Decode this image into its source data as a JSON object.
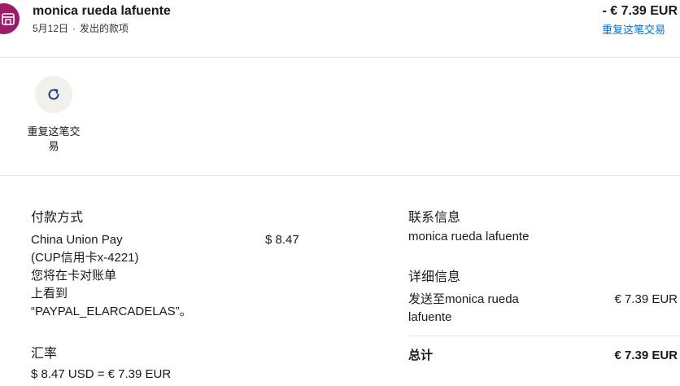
{
  "header": {
    "merchant_name": "monica rueda lafuente",
    "date": "5月12日",
    "separator": "·",
    "type": "发出的款项",
    "amount": "- € 7.39 EUR",
    "repeat_link": "重复这笔交易"
  },
  "actions": {
    "repeat_label": "重复这笔交易"
  },
  "payment": {
    "title": "付款方式",
    "method_lines": [
      "China Union Pay",
      "(CUP信用卡x-4221)",
      "您将在卡对账单",
      "上看到",
      "“PAYPAL_ELARCADELAS”。"
    ],
    "method_amount": "$ 8.47"
  },
  "exchange": {
    "title": "汇率",
    "value": "$ 8.47 USD = € 7.39 EUR"
  },
  "contact": {
    "title": "联系信息",
    "name": "monica rueda lafuente"
  },
  "details": {
    "title": "详细信息",
    "sent_to_line1": "发送至monica rueda",
    "sent_to_line2": "lafuente",
    "sent_amount": "€ 7.39 EUR",
    "total_label": "总计",
    "total_amount": "€ 7.39 EUR"
  },
  "colors": {
    "avatar": "#9b1d6a",
    "link": "#0070e0",
    "action_bg": "#f2f0ec",
    "icon": "#1f3b8f"
  }
}
